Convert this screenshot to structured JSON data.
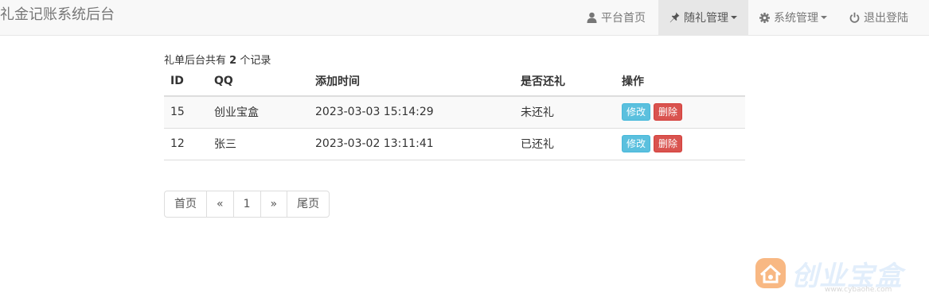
{
  "navbar": {
    "brand": "礼金记账系统后台",
    "items": [
      {
        "label": "平台首页",
        "icon": "user-icon",
        "dropdown": false,
        "active": false
      },
      {
        "label": "随礼管理",
        "icon": "pushpin-icon",
        "dropdown": true,
        "active": true
      },
      {
        "label": "系统管理",
        "icon": "gear-icon",
        "dropdown": true,
        "active": false
      },
      {
        "label": "退出登陆",
        "icon": "power-icon",
        "dropdown": false,
        "active": false
      }
    ]
  },
  "summary": {
    "prefix": "礼单后台共有",
    "count": "2",
    "suffix": "个记录"
  },
  "table": {
    "headers": [
      "ID",
      "QQ",
      "添加时间",
      "是否还礼",
      "操作"
    ],
    "rows": [
      {
        "id": "15",
        "qq": "创业宝盒",
        "time": "2023-03-03 15:14:29",
        "status": "未还礼"
      },
      {
        "id": "12",
        "qq": "张三",
        "time": "2023-03-02 13:11:41",
        "status": "已还礼"
      }
    ],
    "actions": {
      "edit": "修改",
      "delete": "删除"
    }
  },
  "pagination": [
    "首页",
    "«",
    "1",
    "»",
    "尾页"
  ],
  "watermark": {
    "text": "创业宝盒",
    "url": "www.cybaohe.com"
  },
  "colors": {
    "navbar_bg": "#f8f8f8",
    "active_bg": "#e7e7e7",
    "edit_button": "#5bc0de",
    "delete_button": "#d9534f",
    "watermark_orange": "#f5a05a"
  }
}
